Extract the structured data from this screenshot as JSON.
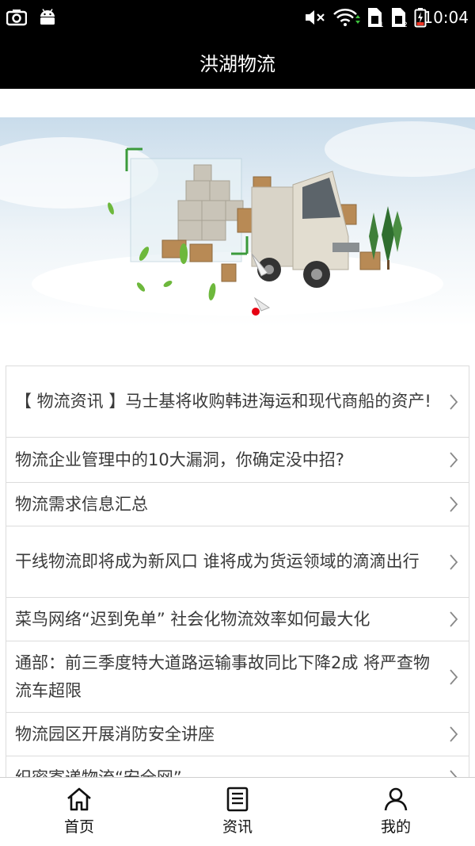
{
  "status_bar": {
    "time": "10:04",
    "icons": [
      "camera-icon",
      "android-icon",
      "mute-icon",
      "wifi-icon",
      "sim1-icon",
      "sim2-icon",
      "battery-charging-icon"
    ]
  },
  "header": {
    "title": "洪湖物流"
  },
  "banner": {
    "image": "logistics-truck-banner",
    "dots": [
      "inactive",
      "inactive",
      "active"
    ],
    "colors": {
      "dot_active": "#e60012",
      "dot_inactive": "#ffffff"
    }
  },
  "news": [
    {
      "title": "【 物流资讯 】马士基将收购韩进海运和现代商船的资产!"
    },
    {
      "title": "物流企业管理中的10大漏洞，你确定没中招?"
    },
    {
      "title": "物流需求信息汇总"
    },
    {
      "title": "干线物流即将成为新风口 谁将成为货运领域的滴滴出行"
    },
    {
      "title": "菜鸟网络“迟到免单” 社会化物流效率如何最大化"
    },
    {
      "title": "通部：前三季度特大道路运输事故同比下降2成 将严查物流车超限"
    },
    {
      "title": "物流园区开展消防安全讲座"
    },
    {
      "title": "织密寄递物流“安全网”"
    }
  ],
  "tabs": [
    {
      "label": "首页",
      "icon": "home-icon"
    },
    {
      "label": "资讯",
      "icon": "news-icon"
    },
    {
      "label": "我的",
      "icon": "user-icon"
    }
  ]
}
